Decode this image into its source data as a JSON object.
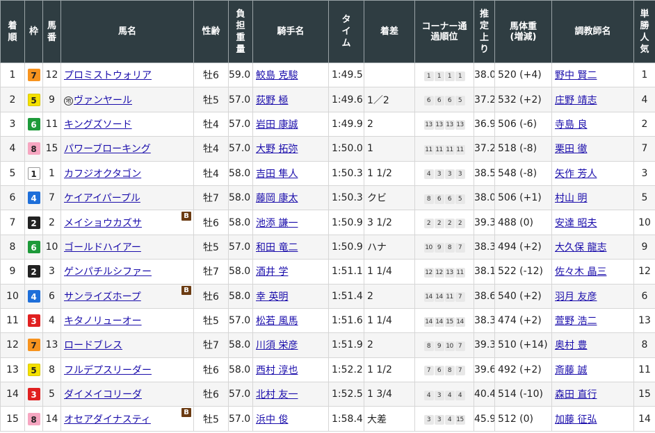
{
  "headers": [
    "着順",
    "枠",
    "馬番",
    "馬名",
    "性齢",
    "負担重量",
    "騎手名",
    "タイム",
    "着差",
    "コーナー通過順位",
    "推定上り",
    "馬体重(増減)",
    "調教師名",
    "単勝人気"
  ],
  "frame_colors": {
    "1": {
      "bg": "#ffffff",
      "fg": "#222222",
      "border": "#999999"
    },
    "2": {
      "bg": "#222222",
      "fg": "#ffffff",
      "border": "#222222"
    },
    "3": {
      "bg": "#e02020",
      "fg": "#ffffff",
      "border": "#e02020"
    },
    "4": {
      "bg": "#1e6fd9",
      "fg": "#ffffff",
      "border": "#1e6fd9"
    },
    "5": {
      "bg": "#f5e100",
      "fg": "#222222",
      "border": "#d8c600"
    },
    "6": {
      "bg": "#1d9a3a",
      "fg": "#ffffff",
      "border": "#1d9a3a"
    },
    "7": {
      "bg": "#f7931e",
      "fg": "#222222",
      "border": "#f7931e"
    },
    "8": {
      "bg": "#f6a6c1",
      "fg": "#222222",
      "border": "#f6a6c1"
    }
  },
  "rows": [
    {
      "rank": "1",
      "frame": "7",
      "num": "12",
      "horse": "プロミストウォリア",
      "prefix": "",
      "blinker": false,
      "sexage": "牡6",
      "weight": "59.0",
      "jockey": "鮫島 克駿",
      "time": "1:49.5",
      "margin": "",
      "corners": [
        "1",
        "1",
        "1",
        "1"
      ],
      "last3f": "38.0",
      "body": "520 (+4)",
      "trainer": "野中 賢二",
      "pop": "1"
    },
    {
      "rank": "2",
      "frame": "5",
      "num": "9",
      "horse": "ヴァンヤール",
      "prefix": "地",
      "blinker": false,
      "sexage": "牡5",
      "weight": "57.0",
      "jockey": "荻野 極",
      "time": "1:49.6",
      "margin": "1／2",
      "corners": [
        "6",
        "6",
        "6",
        "5"
      ],
      "last3f": "37.2",
      "body": "532 (+2)",
      "trainer": "庄野 靖志",
      "pop": "4"
    },
    {
      "rank": "3",
      "frame": "6",
      "num": "11",
      "horse": "キングズソード",
      "prefix": "",
      "blinker": false,
      "sexage": "牡4",
      "weight": "57.0",
      "jockey": "岩田 康誠",
      "time": "1:49.9",
      "margin": "2",
      "corners": [
        "13",
        "13",
        "13",
        "13"
      ],
      "last3f": "36.9",
      "body": "506 (-6)",
      "trainer": "寺島 良",
      "pop": "2"
    },
    {
      "rank": "4",
      "frame": "8",
      "num": "15",
      "horse": "パワーブローキング",
      "prefix": "",
      "blinker": false,
      "sexage": "牡4",
      "weight": "57.0",
      "jockey": "大野 拓弥",
      "time": "1:50.0",
      "margin": "1",
      "corners": [
        "11",
        "11",
        "11",
        "11"
      ],
      "last3f": "37.2",
      "body": "518 (-8)",
      "trainer": "栗田 徹",
      "pop": "7"
    },
    {
      "rank": "5",
      "frame": "1",
      "num": "1",
      "horse": "カフジオクタゴン",
      "prefix": "",
      "blinker": false,
      "sexage": "牡4",
      "weight": "58.0",
      "jockey": "吉田 隼人",
      "time": "1:50.3",
      "margin": "1 1/2",
      "corners": [
        "4",
        "3",
        "3",
        "3"
      ],
      "last3f": "38.5",
      "body": "548 (-8)",
      "trainer": "矢作 芳人",
      "pop": "3"
    },
    {
      "rank": "6",
      "frame": "4",
      "num": "7",
      "horse": "ケイアイパープル",
      "prefix": "",
      "blinker": false,
      "sexage": "牡7",
      "weight": "58.0",
      "jockey": "藤岡 康太",
      "time": "1:50.3",
      "margin": "クビ",
      "corners": [
        "8",
        "6",
        "6",
        "5"
      ],
      "last3f": "38.0",
      "body": "506 (+1)",
      "trainer": "村山 明",
      "pop": "5"
    },
    {
      "rank": "7",
      "frame": "2",
      "num": "2",
      "horse": "メイショウカズサ",
      "prefix": "",
      "blinker": true,
      "sexage": "牡6",
      "weight": "58.0",
      "jockey": "池添 謙一",
      "time": "1:50.9",
      "margin": "3 1/2",
      "corners": [
        "2",
        "2",
        "2",
        "2"
      ],
      "last3f": "39.3",
      "body": "488 (0)",
      "trainer": "安達 昭夫",
      "pop": "10"
    },
    {
      "rank": "8",
      "frame": "6",
      "num": "10",
      "horse": "ゴールドハイアー",
      "prefix": "",
      "blinker": false,
      "sexage": "牡5",
      "weight": "57.0",
      "jockey": "和田 竜二",
      "time": "1:50.9",
      "margin": "ハナ",
      "corners": [
        "10",
        "9",
        "8",
        "7"
      ],
      "last3f": "38.3",
      "body": "494 (+2)",
      "trainer": "大久保 龍志",
      "pop": "9"
    },
    {
      "rank": "9",
      "frame": "2",
      "num": "3",
      "horse": "ゲンパチルシファー",
      "prefix": "",
      "blinker": false,
      "sexage": "牡7",
      "weight": "58.0",
      "jockey": "酒井 学",
      "time": "1:51.1",
      "margin": "1 1/4",
      "corners": [
        "12",
        "12",
        "13",
        "11"
      ],
      "last3f": "38.1",
      "body": "522 (-12)",
      "trainer": "佐々木 晶三",
      "pop": "12"
    },
    {
      "rank": "10",
      "frame": "4",
      "num": "6",
      "horse": "サンライズホープ",
      "prefix": "",
      "blinker": true,
      "sexage": "牡6",
      "weight": "58.0",
      "jockey": "幸 英明",
      "time": "1:51.4",
      "margin": "2",
      "corners": [
        "14",
        "14",
        "11",
        "7"
      ],
      "last3f": "38.6",
      "body": "540 (+2)",
      "trainer": "羽月 友彦",
      "pop": "6"
    },
    {
      "rank": "11",
      "frame": "3",
      "num": "4",
      "horse": "キタノリューオー",
      "prefix": "",
      "blinker": false,
      "sexage": "牡5",
      "weight": "57.0",
      "jockey": "松若 風馬",
      "time": "1:51.6",
      "margin": "1 1/4",
      "corners": [
        "14",
        "14",
        "15",
        "14"
      ],
      "last3f": "38.3",
      "body": "474 (+2)",
      "trainer": "萱野 浩二",
      "pop": "13"
    },
    {
      "rank": "12",
      "frame": "7",
      "num": "13",
      "horse": "ロードブレス",
      "prefix": "",
      "blinker": false,
      "sexage": "牡7",
      "weight": "58.0",
      "jockey": "川須 栄彦",
      "time": "1:51.9",
      "margin": "2",
      "corners": [
        "8",
        "9",
        "10",
        "7"
      ],
      "last3f": "39.3",
      "body": "510 (+14)",
      "trainer": "奥村 豊",
      "pop": "8"
    },
    {
      "rank": "13",
      "frame": "5",
      "num": "8",
      "horse": "フルデプスリーダー",
      "prefix": "",
      "blinker": false,
      "sexage": "牡6",
      "weight": "58.0",
      "jockey": "西村 淳也",
      "time": "1:52.2",
      "margin": "1 1/2",
      "corners": [
        "7",
        "6",
        "8",
        "7"
      ],
      "last3f": "39.6",
      "body": "492 (+2)",
      "trainer": "斎藤 誠",
      "pop": "11"
    },
    {
      "rank": "14",
      "frame": "3",
      "num": "5",
      "horse": "ダイメイコリーダ",
      "prefix": "",
      "blinker": false,
      "sexage": "牡6",
      "weight": "57.0",
      "jockey": "北村 友一",
      "time": "1:52.5",
      "margin": "1 3/4",
      "corners": [
        "4",
        "3",
        "4",
        "4"
      ],
      "last3f": "40.4",
      "body": "514 (-10)",
      "trainer": "森田 直行",
      "pop": "15"
    },
    {
      "rank": "15",
      "frame": "8",
      "num": "14",
      "horse": "オセアダイナスティ",
      "prefix": "",
      "blinker": true,
      "sexage": "牡5",
      "weight": "57.0",
      "jockey": "浜中 俊",
      "time": "1:58.4",
      "margin": "大差",
      "corners": [
        "3",
        "3",
        "4",
        "15"
      ],
      "last3f": "45.9",
      "body": "512 (0)",
      "trainer": "加藤 征弘",
      "pop": "14"
    }
  ],
  "blinker_label": "B"
}
